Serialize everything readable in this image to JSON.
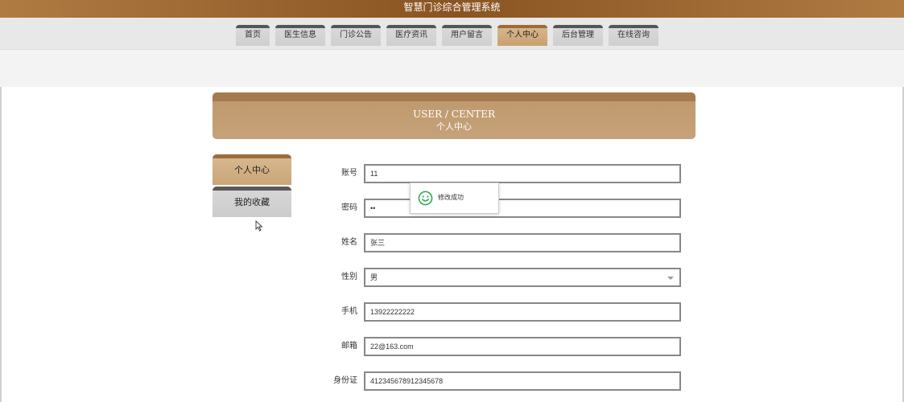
{
  "app": {
    "title": "智慧门诊综合管理系统"
  },
  "nav": {
    "tabs": [
      {
        "label": "首页"
      },
      {
        "label": "医生信息"
      },
      {
        "label": "门诊公告"
      },
      {
        "label": "医疗资讯"
      },
      {
        "label": "用户留言"
      },
      {
        "label": "个人中心",
        "active": true
      },
      {
        "label": "后台管理"
      },
      {
        "label": "在线咨询"
      }
    ]
  },
  "header": {
    "en": "USER / CENTER",
    "zh": "个人中心"
  },
  "sidebar": {
    "items": [
      {
        "label": "个人中心",
        "active": true
      },
      {
        "label": "我的收藏"
      }
    ]
  },
  "form": {
    "account": {
      "label": "账号",
      "value": "11"
    },
    "password": {
      "label": "密码",
      "value": "••"
    },
    "name": {
      "label": "姓名",
      "value": "张三"
    },
    "gender": {
      "label": "性别",
      "value": "男"
    },
    "phone": {
      "label": "手机",
      "value": "13922222222"
    },
    "email": {
      "label": "邮箱",
      "value": "22@163.com"
    },
    "idcard": {
      "label": "身份证",
      "value": "412345678912345678"
    }
  },
  "toast": {
    "message": "修改成功",
    "icon": "smile-icon",
    "color": "#2aa84a"
  },
  "colors": {
    "brand": "#8a5422",
    "accent": "#c6a27a"
  }
}
